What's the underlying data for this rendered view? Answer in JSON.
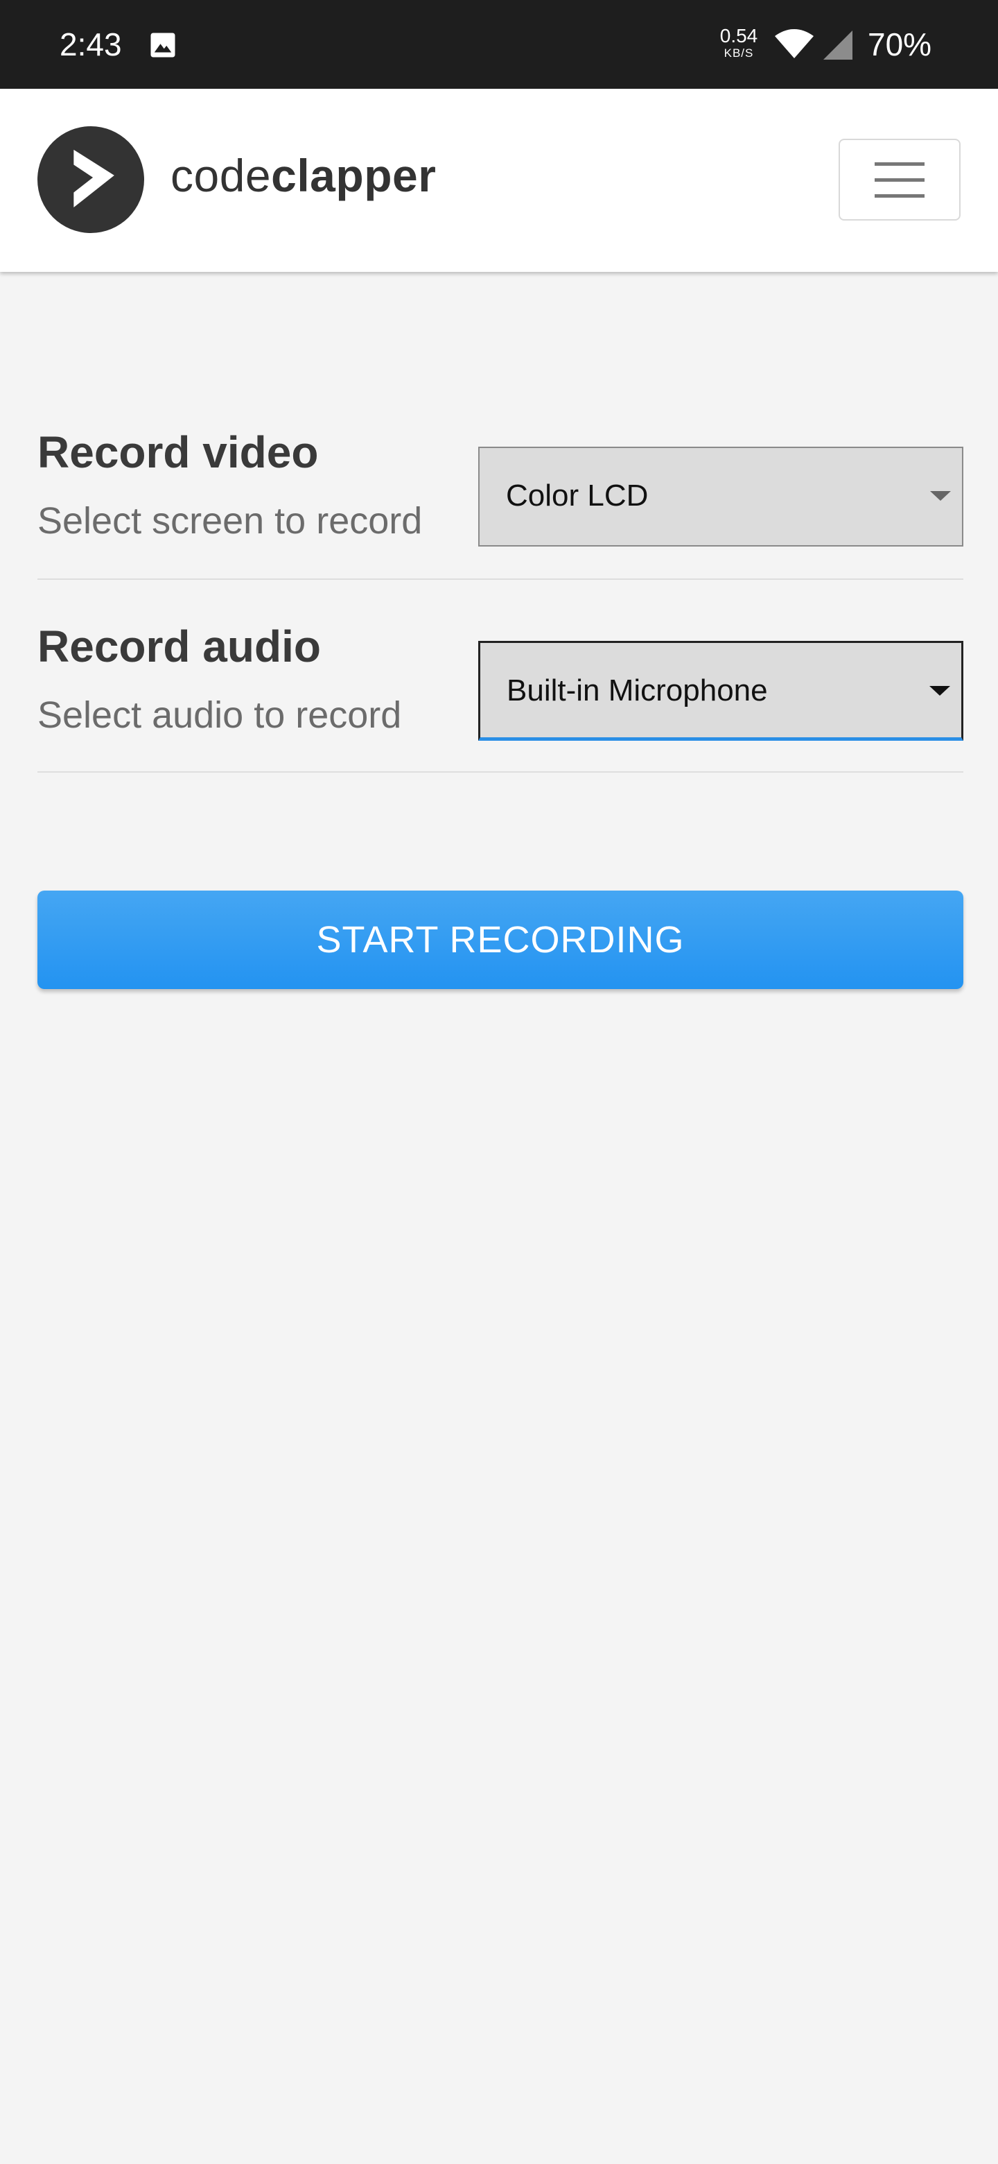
{
  "status_bar": {
    "time": "2:43",
    "network_speed_value": "0.54",
    "network_speed_unit": "KB/S",
    "battery": "70%",
    "icons": [
      "image-icon",
      "wifi-icon",
      "signal-icon"
    ]
  },
  "header": {
    "brand_light": "code",
    "brand_bold": "clapper",
    "menu_icon": "hamburger-menu-icon"
  },
  "form": {
    "video": {
      "title": "Record video",
      "subtitle": "Select screen to record",
      "selected": "Color LCD"
    },
    "audio": {
      "title": "Record audio",
      "subtitle": "Select audio to record",
      "selected": "Built-in Microphone"
    }
  },
  "actions": {
    "start_label": "START RECORDING"
  },
  "colors": {
    "status_bar_bg": "#1e1e1e",
    "page_bg": "#f4f4f4",
    "accent_blue": "#2393f1",
    "logo_dark": "#333333"
  }
}
